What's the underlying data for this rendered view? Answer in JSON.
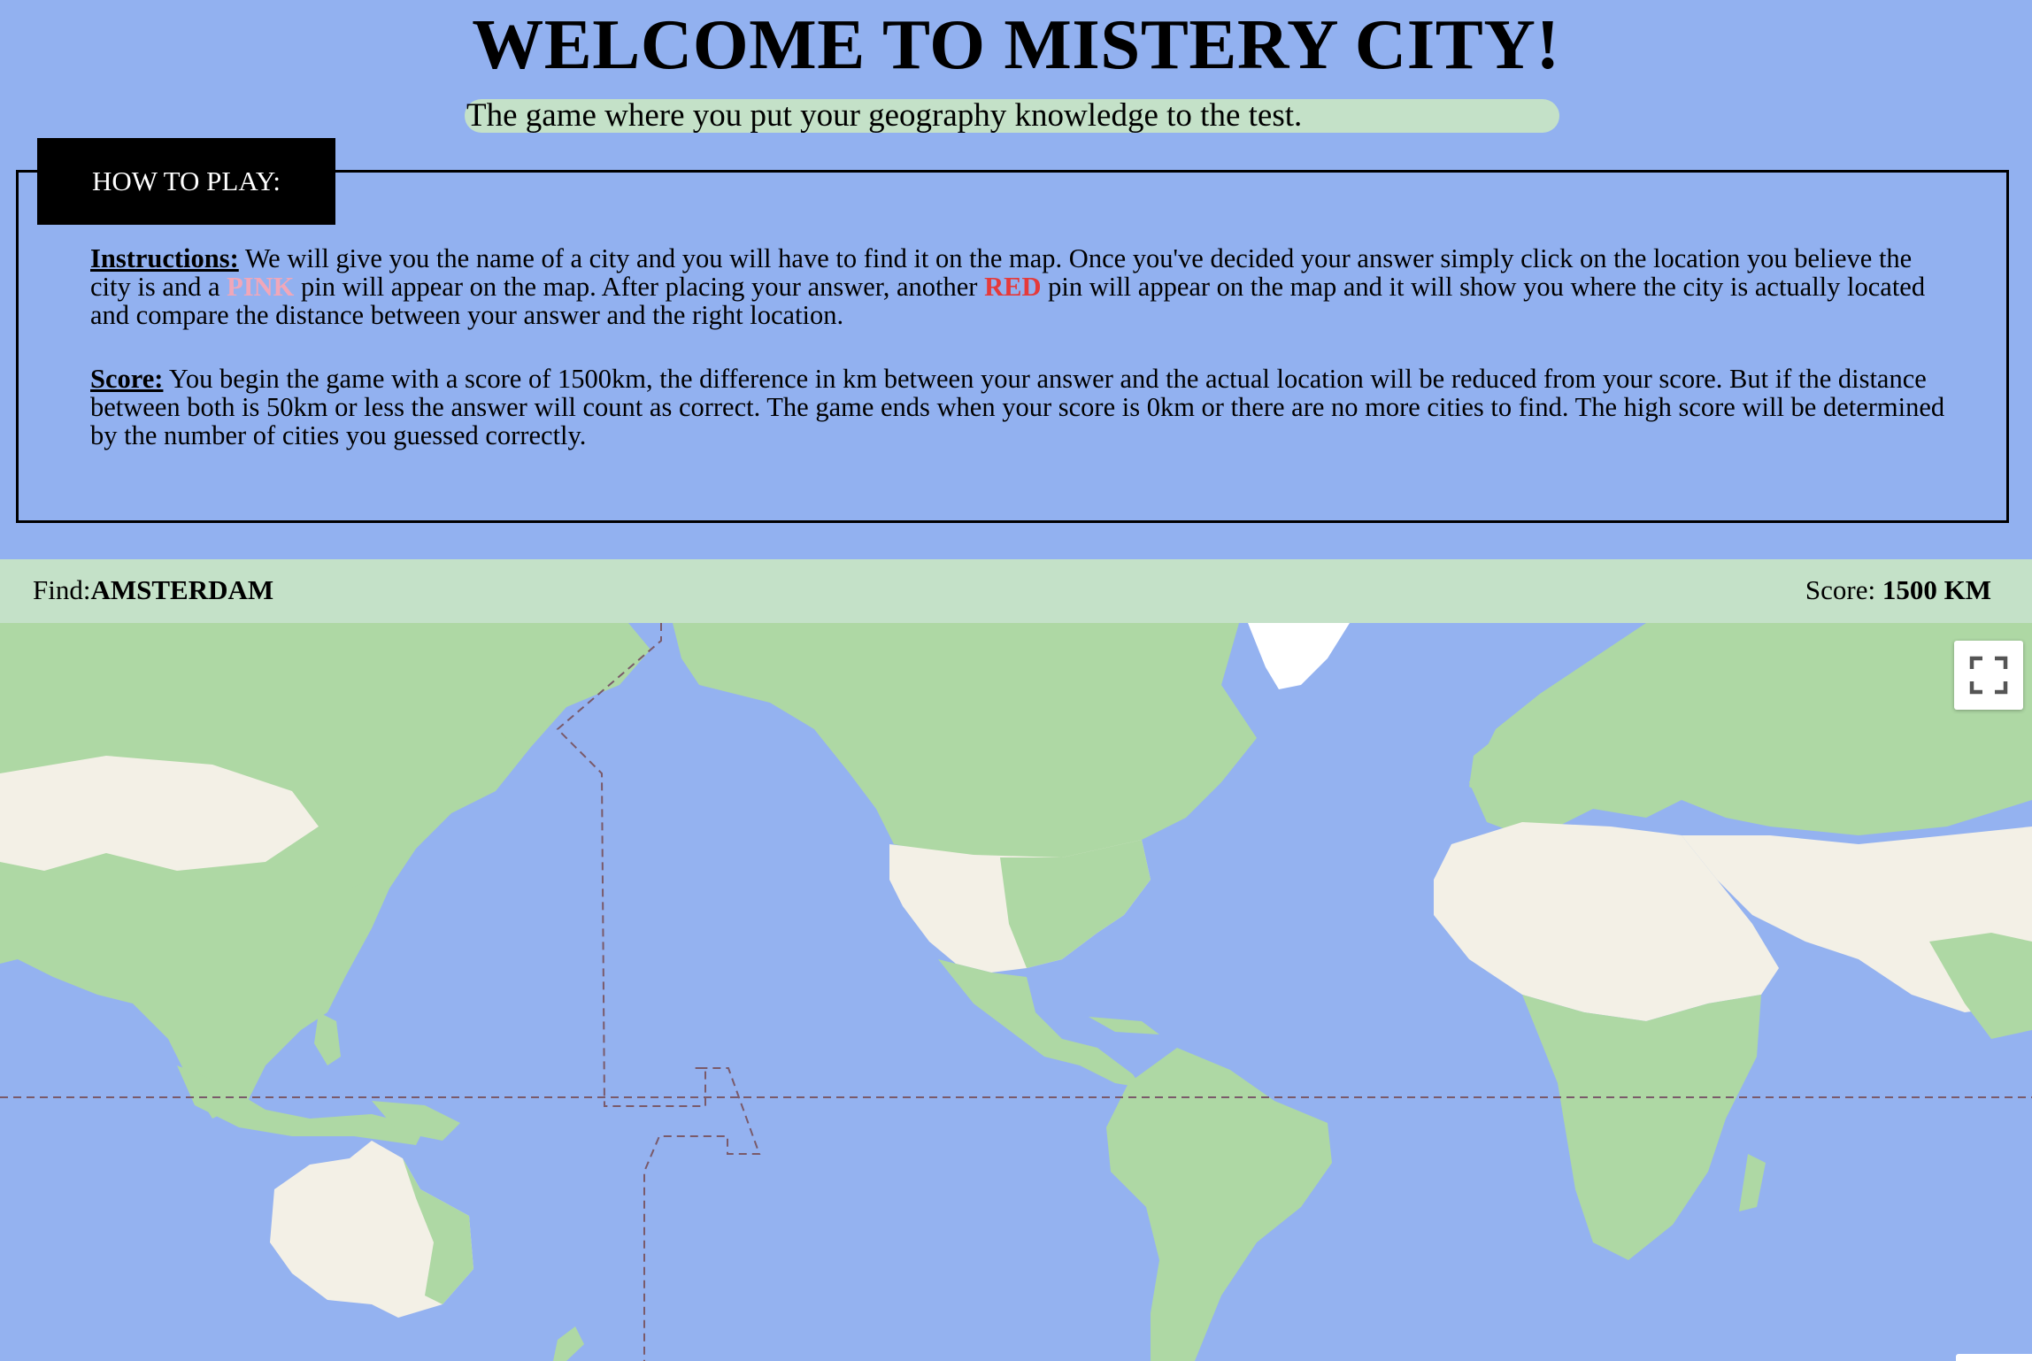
{
  "header": {
    "title": "WELCOME TO MISTERY CITY!",
    "subtitle": "The game where you put your geography knowledge to the test."
  },
  "how_to_play": {
    "tab_label": "HOW TO PLAY:",
    "instructions": {
      "label": "Instructions:",
      "text_1": " We will give you the name of a city and you will have to find it on the map. Once you've decided your answer simply click on the location you believe the city is and a ",
      "pink": "PINK",
      "text_2": " pin will appear on the map. After placing your answer, another ",
      "red": "RED",
      "text_3": " pin will appear on the map and it will show you where the city is actually located and compare the distance between your answer and the right location."
    },
    "score": {
      "label": "Score:",
      "text": " You begin the game with a score of 1500km, the difference in km between your answer and the actual location will be reduced from your score. But if the distance between both is 50km or less the answer will count as correct. The game ends when your score is 0km or there are no more cities to find. The high score will be determined by the number of cities you guessed correctly."
    }
  },
  "game_bar": {
    "find_label": "Find:",
    "city": "AMSTERDAM",
    "score_label": "Score: ",
    "score_value": "1500 KM"
  },
  "map": {
    "fullscreen_icon": "fullscreen-icon"
  },
  "colors": {
    "page_background": "#92b1f0",
    "accent_green": "#c4e1c8",
    "pin_guess": "#f1a7b9",
    "pin_actual": "#e53a3a",
    "ocean": "#94b2f0",
    "land": "#aed8a4",
    "desert": "#f3f0e6"
  }
}
